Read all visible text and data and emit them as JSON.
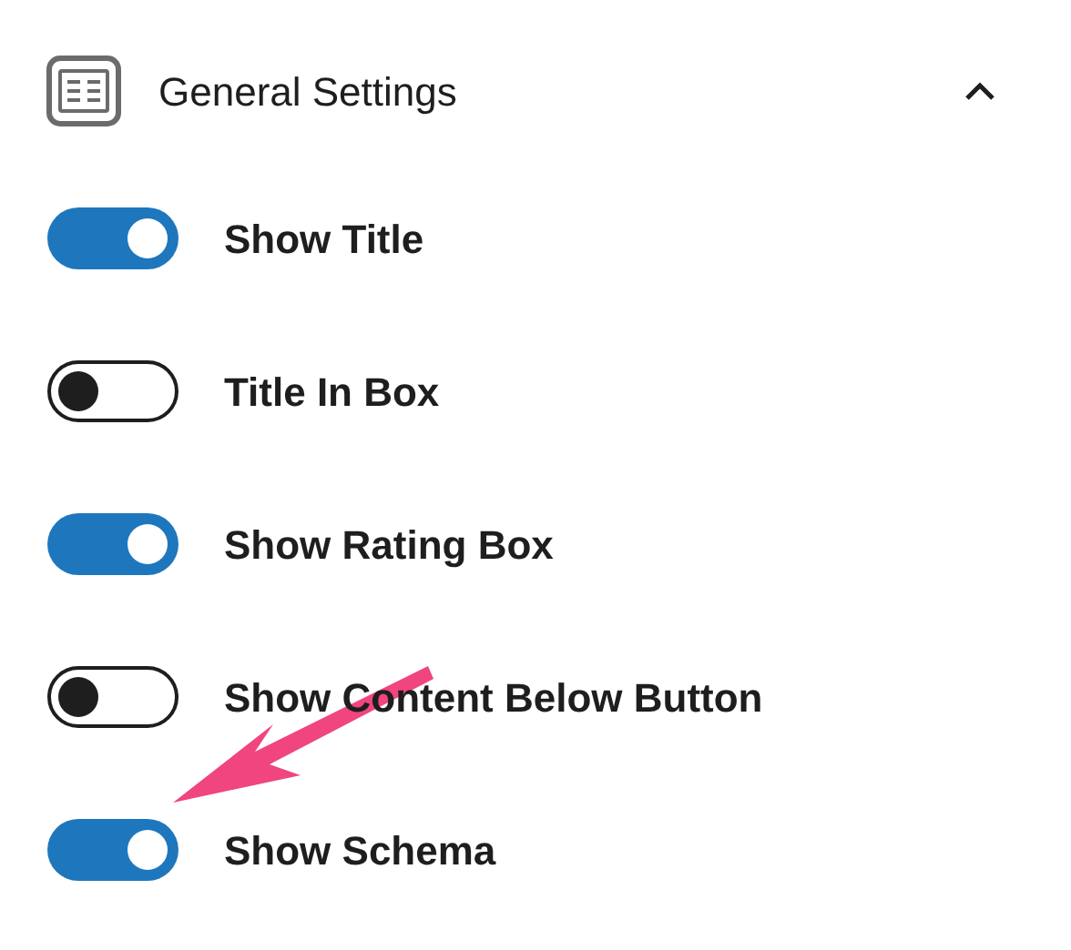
{
  "panel": {
    "title": "General Settings",
    "expanded": true
  },
  "toggles": [
    {
      "label": "Show Title",
      "on": true
    },
    {
      "label": "Title In Box",
      "on": false
    },
    {
      "label": "Show Rating Box",
      "on": true
    },
    {
      "label": "Show Content Below Button",
      "on": false
    },
    {
      "label": "Show Schema",
      "on": true
    }
  ]
}
